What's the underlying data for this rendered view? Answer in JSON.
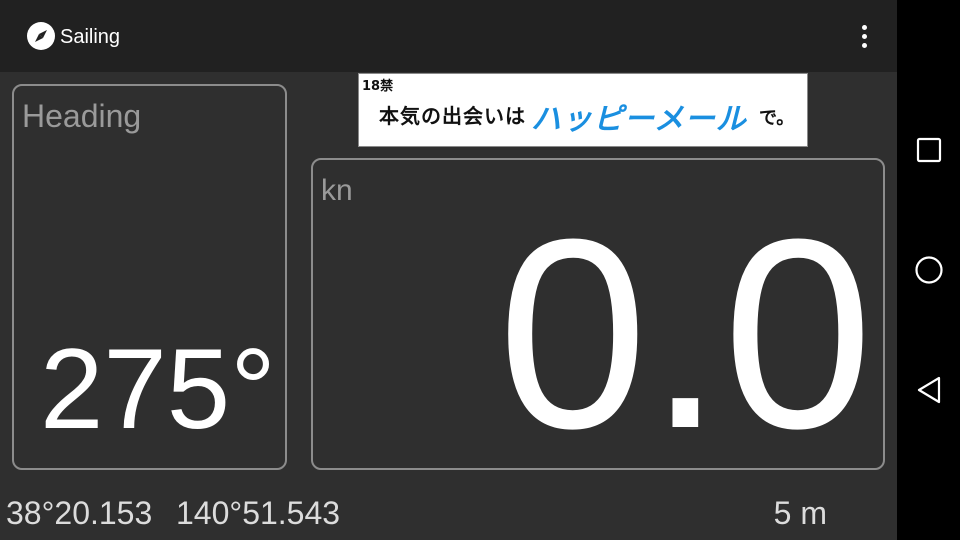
{
  "app": {
    "title": "Sailing",
    "icon": "compass-icon",
    "menu_icon": "overflow-menu-icon"
  },
  "ad": {
    "age_notice": "18禁",
    "lead_text": "本気の出会いは",
    "brand_text": "ハッピーメール",
    "tail_text": "で。"
  },
  "heading_panel": {
    "label": "Heading",
    "value": "275°"
  },
  "speed_panel": {
    "label": "kn",
    "value": "0.0"
  },
  "footer": {
    "latitude": "38°20.153",
    "longitude": "140°51.543",
    "accuracy": "5 m"
  },
  "system_nav": {
    "recents_icon": "square-recents-icon",
    "home_icon": "circle-home-icon",
    "back_icon": "triangle-back-icon"
  },
  "colors": {
    "background": "#2f2f2f",
    "appbar": "#212121",
    "panel_border": "#8c8c8c",
    "label": "#9a9a9a",
    "value": "#ffffff",
    "ad_brand": "#1a8fe0",
    "navbar": "#000000"
  }
}
